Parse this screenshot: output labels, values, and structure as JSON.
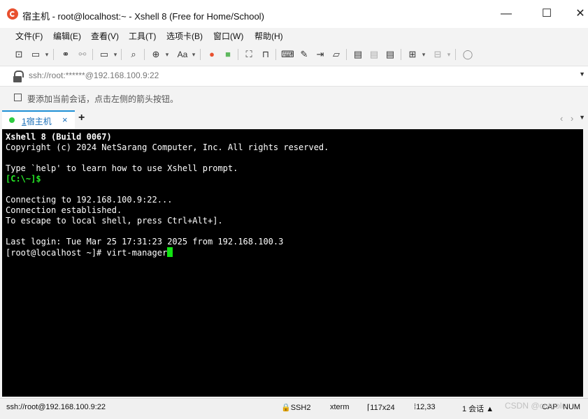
{
  "window": {
    "title": "宿主机 - root@localhost:~ - Xshell 8 (Free for Home/School)",
    "controls": {
      "minimize": "—",
      "maximize": "☐",
      "close": "✕"
    }
  },
  "menu": {
    "items": [
      "文件(F)",
      "编辑(E)",
      "查看(V)",
      "工具(T)",
      "选项卡(B)",
      "窗口(W)",
      "帮助(H)"
    ]
  },
  "address": {
    "value": "ssh://root:******@192.168.100.9:22"
  },
  "hint": {
    "text": "要添加当前会话，点击左侧的箭头按钮。"
  },
  "tabs": [
    {
      "number": "1",
      "label": "宿主机",
      "close": "×",
      "status_color": "#2ecc40"
    }
  ],
  "tab_add": "+",
  "terminal": {
    "lines": [
      "Xshell 8 (Build 0067)",
      "Copyright (c) 2024 NetSarang Computer, Inc. All rights reserved.",
      "",
      "Type `help' to learn how to use Xshell prompt.",
      "[C:\\~]$",
      "",
      "Connecting to 192.168.100.9:22...",
      "Connection established.",
      "To escape to local shell, press Ctrl+Alt+].",
      "",
      "Last login: Tue Mar 25 17:31:23 2025 from 192.168.100.3"
    ],
    "prompt_line": "[root@localhost ~]# virt-manager"
  },
  "status": {
    "address": "ssh://root@192.168.100.9:22",
    "protocol": "SSH2",
    "terminal_type": "xterm",
    "size": "117x24",
    "cursor_pos": "12,33",
    "sessions": "1 会话",
    "cap": "CAP",
    "num": "NUM"
  },
  "watermark": "CSDN @cntuolu",
  "colors": {
    "accent": "#1e90d6",
    "terminal_bg": "#000000",
    "cursor": "#11e311",
    "prompt_green": "#27e827"
  }
}
